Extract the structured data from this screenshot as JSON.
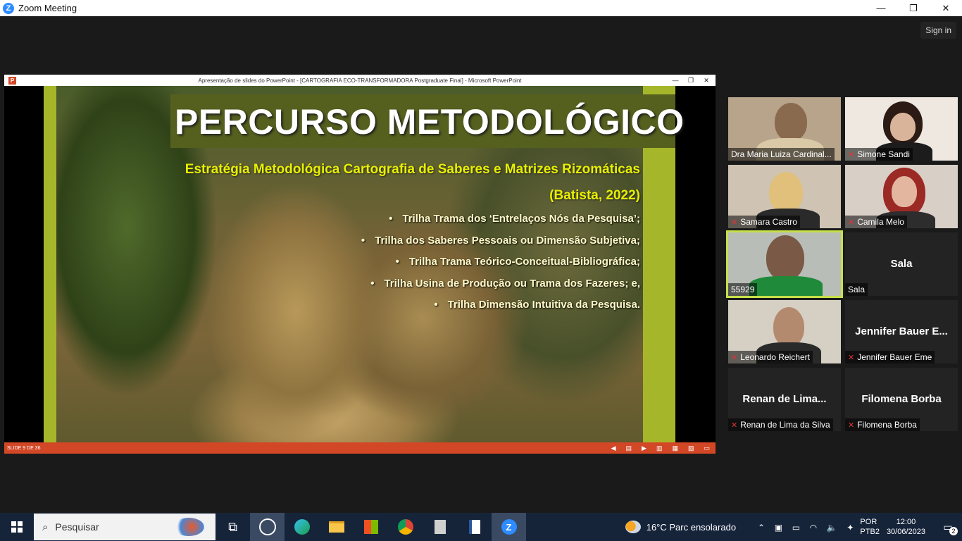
{
  "window": {
    "title": "Zoom Meeting",
    "controls": {
      "minimize": "—",
      "maximize": "❐",
      "close": "✕"
    },
    "sign_in": "Sign in"
  },
  "powerpoint": {
    "title": "Apresentação de slides do PowerPoint - [CARTOGRAFIA ECO-TRANSFORMADORA Postgraduate Final] - Microsoft PowerPoint",
    "controls": {
      "minimize": "—",
      "restore": "❐",
      "close": "✕"
    },
    "slide": {
      "title": "PERCURSO METODOLÓGICO",
      "subtitle_line1": "Estratégia Metodológica Cartografia de Saberes e Matrizes Rizomáticas",
      "subtitle_line2": "(Batista, 2022)",
      "bullets": [
        "Trilha Trama dos ‘Entrelaços Nós da Pesquisa’;",
        "Trilha dos Saberes Pessoais ou Dimensão Subjetiva;",
        "Trilha Trama Teórico-Conceitual-Bibliográfica;",
        "Trilha Usina de Produção ou Trama dos Fazeres; e,",
        "Trilha Dimensão Intuitiva da Pesquisa."
      ]
    },
    "status": {
      "slide_counter": "SLIDE 9 DE 36"
    }
  },
  "participants": [
    {
      "name": "Dra Maria Luiza Cardinal...",
      "muted": false,
      "video": true
    },
    {
      "name": "Simone Sandi",
      "muted": true,
      "video": true
    },
    {
      "name": "Samara Castro",
      "muted": true,
      "video": true
    },
    {
      "name": "Camila Melo",
      "muted": true,
      "video": true
    },
    {
      "name": "55929",
      "muted": false,
      "video": true,
      "active_speaker": true
    },
    {
      "name": "Sala",
      "display": "Sala",
      "muted": false,
      "video": false
    },
    {
      "name": "Leonardo Reichert",
      "muted": true,
      "video": true
    },
    {
      "name": "Jennifer Bauer Eme",
      "display": "Jennifer Bauer E...",
      "muted": true,
      "video": false
    },
    {
      "name": "Renan de Lima da Silva",
      "display": "Renan de Lima...",
      "muted": true,
      "video": false
    },
    {
      "name": "Filomena Borba",
      "display": "Filomena Borba",
      "muted": true,
      "video": false
    }
  ],
  "taskbar": {
    "search_placeholder": "Pesquisar",
    "weather": "16°C  Parc ensolarado",
    "language": [
      "POR",
      "PTB2"
    ],
    "time": "12:00",
    "date": "30/06/2023",
    "notifications": "2"
  },
  "colors": {
    "slide_green": "#a6b62a",
    "title_band": "#55601e",
    "subtitle_yellow": "#e8f000",
    "ppt_status": "#d24726",
    "active_speaker": "#c6e04a",
    "taskbar": "#16243a"
  }
}
